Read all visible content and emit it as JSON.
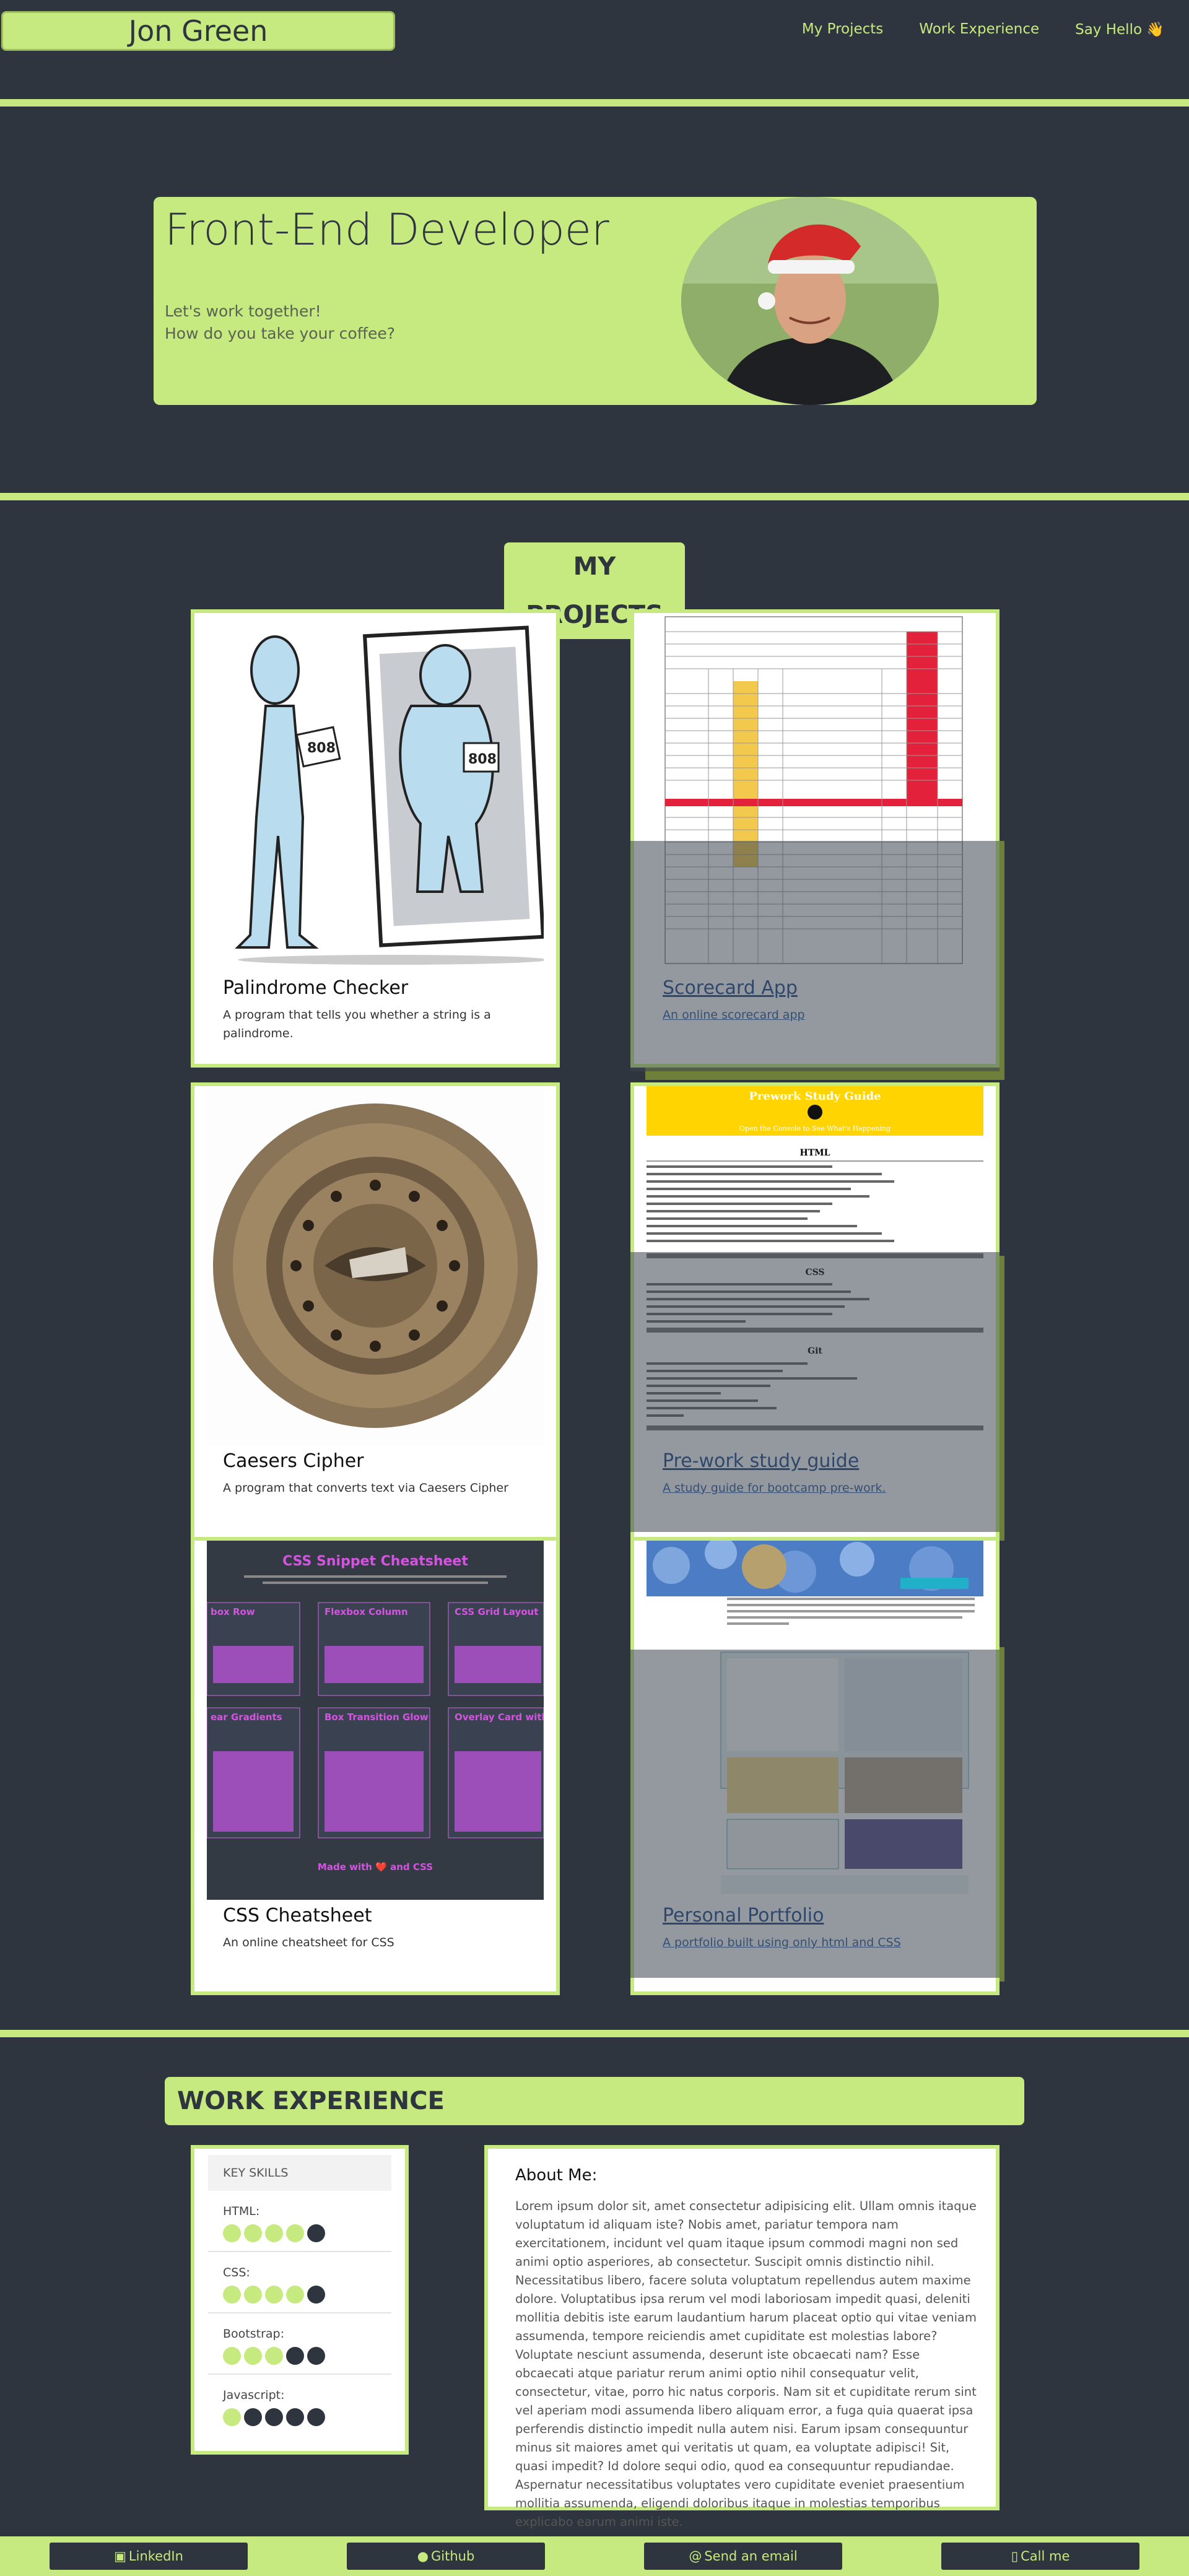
{
  "nav": {
    "brand": "Jon Green",
    "links": [
      "My Projects",
      "Work Experience",
      "Say Hello 👋"
    ]
  },
  "hero": {
    "title": "Front-End Developer",
    "tagline_1": "Let's work together!",
    "tagline_2": "How do you take your coffee?"
  },
  "projects": {
    "title": "MY PROJECTS",
    "items": [
      {
        "name": "Palindrome Checker",
        "desc": "A program that tells you whether a string is a palindrome."
      },
      {
        "name": "Scorecard App",
        "desc": "An online scorecard app"
      },
      {
        "name": "Caesers Cipher",
        "desc": "A program that converts text via Caesers Cipher"
      },
      {
        "name": "Pre-work study guide",
        "desc": "A study guide for bootcamp pre-work."
      },
      {
        "name": "CSS Cheatsheet",
        "desc": "An online cheatsheet for CSS"
      },
      {
        "name": "Personal Portfolio",
        "desc": "A portfolio built using only html and CSS"
      }
    ],
    "thumbs": {
      "mirror_badge": "808",
      "cheatsheet_title": "CSS Snippet Cheatsheet",
      "cheatsheet_made": "Made with ❤️ and CSS",
      "cheatsheet_cards": [
        "box Row",
        "Flexbox Column",
        "CSS Grid Layout",
        "ear Gradients",
        "Box Transition Glow",
        "Overlay Card with Title"
      ],
      "study_title": "Prework Study Guide",
      "study_subtitle": "Open the Console to See What's Happening",
      "study_sections": [
        "HTML",
        "CSS",
        "Git"
      ]
    }
  },
  "work": {
    "title": "WORK EXPERIENCE",
    "skills_header": "KEY SKILLS",
    "skills": [
      {
        "name": "HTML:",
        "level": 4,
        "max": 5
      },
      {
        "name": "CSS:",
        "level": 4,
        "max": 5
      },
      {
        "name": "Bootstrap:",
        "level": 3,
        "max": 5
      },
      {
        "name": "Javascript:",
        "level": 1,
        "max": 5
      }
    ],
    "about_title": "About Me:",
    "about_text": "Lorem ipsum dolor sit, amet consectetur adipisicing elit. Ullam omnis itaque voluptatum id aliquam iste? Nobis amet, pariatur tempora nam exercitationem, incidunt vel quam itaque ipsum commodi magni non sed animi optio asperiores, ab consectetur. Suscipit omnis distinctio nihil. Necessitatibus libero, facere soluta voluptatum repellendus autem maxime dolore. Voluptatibus ipsa rerum vel modi laboriosam impedit quasi, deleniti mollitia debitis iste earum laudantium harum placeat optio qui vitae veniam assumenda, tempore reiciendis amet cupiditate est molestias labore? Voluptate nesciunt assumenda, deserunt iste obcaecati nam? Esse obcaecati atque pariatur rerum animi optio nihil consequatur velit, consectetur, vitae, porro hic natus corporis. Nam sit et cupiditate rerum sint vel aperiam modi assumenda libero aliquam error, a fuga quia quaerat ipsa perferendis distinctio impedit nulla autem nisi. Earum ipsam consequuntur minus sit maiores amet qui veritatis ut quam, ea voluptate adipisci! Sit, quasi impedit? Id dolore sequi odio, quod ea consequuntur repudiandae. Aspernatur necessitatibus voluptates vero cupiditate eveniet praesentium mollitia assumenda, eligendi doloribus itaque in molestias temporibus explicabo earum animi iste."
  },
  "footer": {
    "links": [
      "LinkedIn",
      "Github",
      "Send an email",
      "Call me"
    ]
  },
  "colors": {
    "accent": "#c6ea7f",
    "background": "#2f353f"
  }
}
